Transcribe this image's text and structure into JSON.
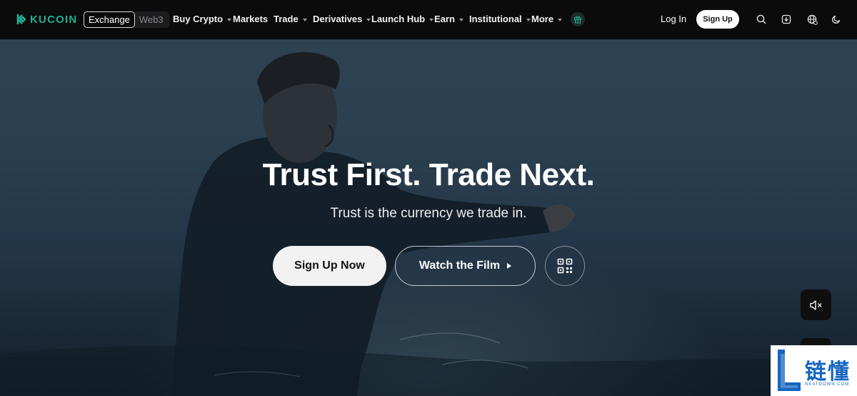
{
  "brand": {
    "name": "KUCOIN",
    "color": "#23af91"
  },
  "switcher": {
    "exchange": "Exchange",
    "web3": "Web3"
  },
  "nav": [
    {
      "label": "Buy Crypto",
      "has_dropdown": true
    },
    {
      "label": "Markets",
      "has_dropdown": false
    },
    {
      "label": "Trade",
      "has_dropdown": true
    },
    {
      "label": "Derivatives",
      "has_dropdown": true
    },
    {
      "label": "Launch Hub",
      "has_dropdown": true
    },
    {
      "label": "Earn",
      "has_dropdown": true
    },
    {
      "label": "Institutional",
      "has_dropdown": true
    },
    {
      "label": "More",
      "has_dropdown": true
    }
  ],
  "header_actions": {
    "login": "Log In",
    "signup": "Sign Up",
    "icons": [
      "gift-icon",
      "search-icon",
      "download-icon",
      "globe-icon",
      "moon-icon"
    ]
  },
  "hero": {
    "title": "Trust First. Trade Next.",
    "subtitle": "Trust is the currency we trade in.",
    "primary_button": "Sign Up Now",
    "secondary_button": "Watch the Film",
    "qr_icon": "qr-code-icon",
    "mute_icon": "speaker-muted-icon"
  },
  "watermark": {
    "text": "链懂",
    "sub": "NEATDOWN.COM"
  }
}
